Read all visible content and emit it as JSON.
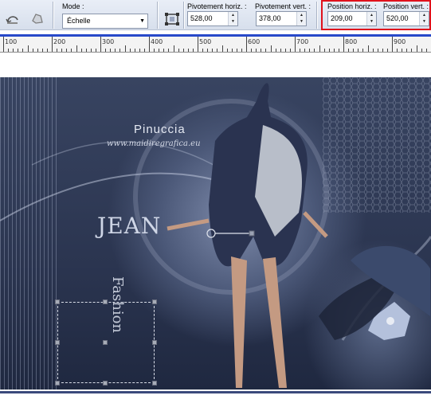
{
  "toolbar": {
    "mode_label": "Mode :",
    "mode_value": "Échelle",
    "pivot_h_label": "Pivotement horiz. :",
    "pivot_h_value": "528,00",
    "pivot_v_label": "Pivotement vert. :",
    "pivot_v_value": "378,00",
    "pos_h_label": "Position horiz. :",
    "pos_h_value": "209,00",
    "pos_v_label": "Position vert. :",
    "pos_v_value": "520,00",
    "icons": [
      "undo-arrow-icon",
      "puppet-icon",
      "scale-box-icon"
    ]
  },
  "ruler": {
    "labels": [
      "100",
      "200",
      "300",
      "400",
      "500",
      "600",
      "700",
      "800",
      "900"
    ]
  },
  "canvas": {
    "watermark_title": "Pinuccia",
    "watermark_url": "www.maidiregrafica.eu",
    "logo_initials": "JEAN",
    "logo_word": "Fashion"
  },
  "colors": {
    "highlight": "#e0121c",
    "ruler_bar": "#2749c9"
  }
}
